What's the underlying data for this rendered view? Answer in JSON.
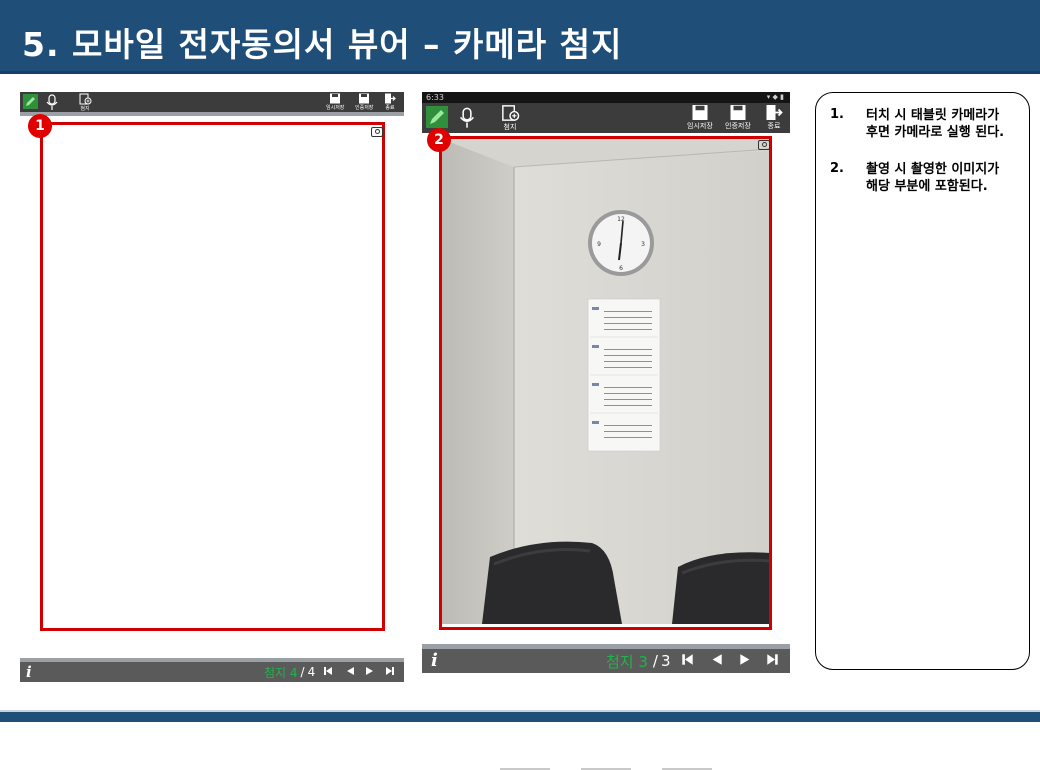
{
  "header": {
    "title": "5. 모바일 전자동의서 뷰어 – 카메라 첨지"
  },
  "screen1": {
    "badge": "1",
    "toolbar": {
      "attach_label": "첨지",
      "temp_save_label": "임시저장",
      "cert_save_label": "인증저장",
      "exit_label": "종료"
    },
    "pager": {
      "label": "첨지 4",
      "separator": "/",
      "total": "4"
    }
  },
  "screen2": {
    "badge": "2",
    "status_time": "6:33",
    "toolbar": {
      "attach_label": "첨지",
      "temp_save_label": "임시저장",
      "cert_save_label": "인증저장",
      "exit_label": "종료"
    },
    "pager": {
      "label": "첨지 3",
      "separator": "/",
      "total": "3"
    }
  },
  "notes": [
    {
      "num": "1.",
      "text": "터치 시 태블릿 카메라가 후면 카메라로 실행 된다."
    },
    {
      "num": "2.",
      "text": "촬영 시 촬영한 이미지가 해당 부분에 포함된다."
    }
  ],
  "colors": {
    "header": "#1f4e79",
    "highlight": "#d00000",
    "badge": "#e00000",
    "pager_label": "#22b34c",
    "toolbar": "#3c3c3c"
  },
  "icons": [
    "pen-icon",
    "microphone-icon",
    "attach-document-icon",
    "floppy-disk-icon",
    "exit-icon",
    "camera-icon",
    "info-icon",
    "first-page-icon",
    "prev-page-icon",
    "next-page-icon",
    "last-page-icon"
  ]
}
